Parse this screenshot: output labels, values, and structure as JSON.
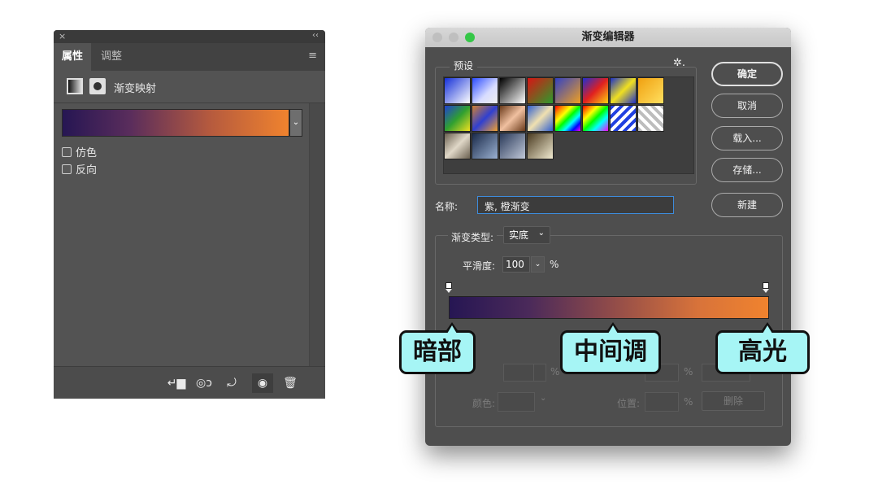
{
  "properties_panel": {
    "close_glyph": "×",
    "collapse_glyph": "‹‹",
    "tabs": [
      {
        "label": "属性"
      },
      {
        "label": "调整"
      }
    ],
    "menu_glyph": "≡",
    "header_label": "渐变映射",
    "dropdown_glyph": "⌄",
    "checkboxes": [
      {
        "label": "仿色",
        "checked": false
      },
      {
        "label": "反向",
        "checked": false
      }
    ],
    "gradient_colors": [
      "#261653",
      "#f0832e"
    ],
    "footer_icons": [
      "clip-to-layer-icon",
      "view-previous-state-icon",
      "reset-icon",
      "visibility-eye-icon",
      "trash-icon"
    ],
    "footer_glyphs": {
      "clip": "↵▆",
      "prev": "◎ↄ",
      "reset": "⤾",
      "eye": "◉",
      "trash": "🗑"
    }
  },
  "gradient_editor": {
    "title": "渐变编辑器",
    "presets_label": "预设",
    "gear_glyph": "✲.",
    "buttons": {
      "ok": "确定",
      "cancel": "取消",
      "load": "载入...",
      "save": "存储...",
      "new": "新建"
    },
    "name_label": "名称:",
    "name_value": "紫, 橙渐变",
    "gradient_type_label": "渐变类型:",
    "gradient_type_value": "实底",
    "select_glyph": "⌄",
    "smoothness_label": "平滑度:",
    "smoothness_value": "100",
    "percent": "%",
    "color_label": "颜色:",
    "location_label": "位置:",
    "delete_label": "删除",
    "gradient_colors": [
      "#261653",
      "#f0832e"
    ]
  },
  "callouts": {
    "shadows": "暗部",
    "midtones": "中间调",
    "highlights": "高光"
  }
}
